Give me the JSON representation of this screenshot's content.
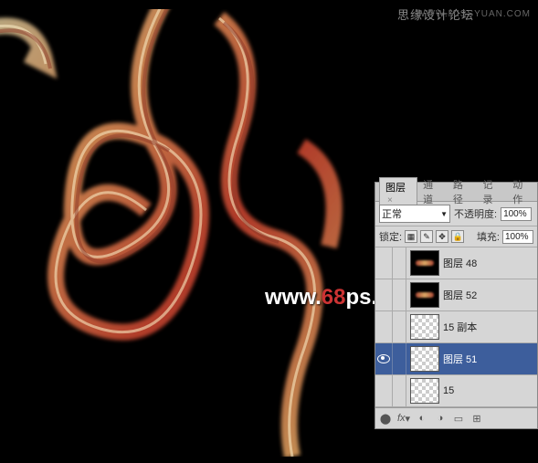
{
  "header": {
    "title": "思缘设计论坛",
    "url": "WWW.MISSYUAN.COM"
  },
  "watermark": {
    "prefix": "www.",
    "mid": "68",
    "suffix": "ps",
    "ext": ".com"
  },
  "panel": {
    "tabs": [
      "图层",
      "通道",
      "路径",
      "记录",
      "动作"
    ],
    "active_tab": 0,
    "blend_mode": "正常",
    "opacity_label": "不透明度:",
    "opacity_value": "100%",
    "lock_label": "锁定:",
    "fill_label": "填充:",
    "fill_value": "100%",
    "layers": [
      {
        "name": "图层 48",
        "visible": false,
        "thumb": "dark",
        "selected": false
      },
      {
        "name": "图层 52",
        "visible": false,
        "thumb": "dark",
        "selected": false
      },
      {
        "name": "15 副本",
        "visible": false,
        "thumb": "checker",
        "selected": false
      },
      {
        "name": "图层 51",
        "visible": true,
        "thumb": "checker",
        "selected": true
      },
      {
        "name": "15",
        "visible": false,
        "thumb": "checker",
        "selected": false
      }
    ]
  }
}
